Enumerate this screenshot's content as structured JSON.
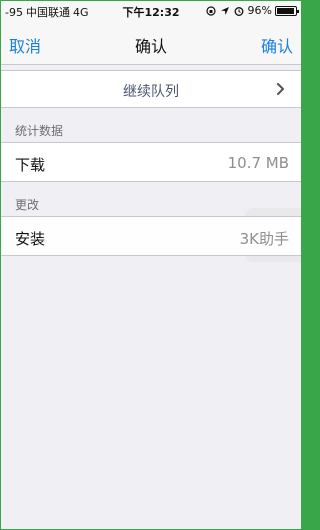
{
  "status_bar": {
    "signal": "-95",
    "carrier": "中国联通",
    "network": "4G",
    "time": "下午12:32",
    "battery_percent": "96%",
    "battery_level": 0.96,
    "icons": [
      "rotation-lock-icon",
      "location-icon",
      "alarm-icon",
      "battery-icon"
    ]
  },
  "nav": {
    "cancel_label": "取消",
    "title": "确认",
    "confirm_label": "确认",
    "accent_color": "#1a7fe0"
  },
  "queue": {
    "label": "继续队列"
  },
  "stats": {
    "header": "统计数据",
    "download_label": "下载",
    "download_value": "10.7 MB"
  },
  "changes": {
    "header": "更改",
    "install_label": "安装",
    "install_value": "3K助手"
  }
}
